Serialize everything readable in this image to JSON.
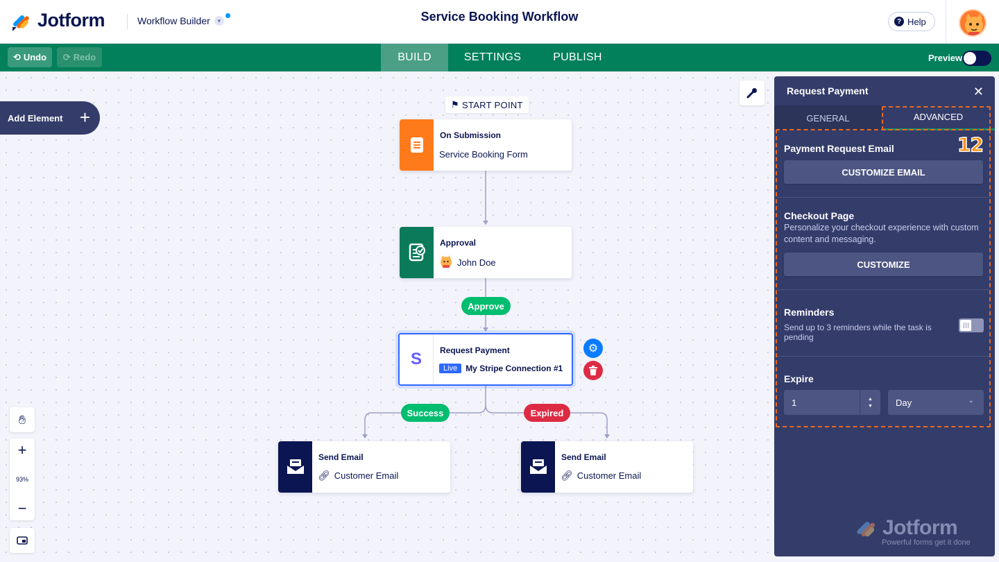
{
  "header": {
    "brand": "Jotform",
    "app_name": "Workflow Builder",
    "doc_title": "Service Booking Workflow",
    "help_label": "Help"
  },
  "nav": {
    "undo": "Undo",
    "redo": "Redo",
    "tabs": [
      "BUILD",
      "SETTINGS",
      "PUBLISH"
    ],
    "active_tab": "BUILD",
    "preview_label": "Preview"
  },
  "canvas": {
    "add_element": "Add Element",
    "start_point": "START POINT",
    "zoom": "93%",
    "nodes": {
      "submission": {
        "title": "On Submission",
        "subtitle": "Service Booking Form"
      },
      "approval": {
        "title": "Approval",
        "assignee": "John Doe"
      },
      "payment": {
        "title": "Request Payment",
        "mode_badge": "Live",
        "connection": "My Stripe Connection #1"
      },
      "email_success": {
        "title": "Send Email",
        "recipient": "Customer Email"
      },
      "email_expired": {
        "title": "Send Email",
        "recipient": "Customer Email"
      }
    },
    "branch_labels": {
      "approve": "Approve",
      "success": "Success",
      "expired": "Expired"
    }
  },
  "panel": {
    "title": "Request Payment",
    "tabs": [
      "GENERAL",
      "ADVANCED"
    ],
    "active_tab": "ADVANCED",
    "annotation_number": "12",
    "payment_email": {
      "title": "Payment Request Email",
      "button": "CUSTOMIZE EMAIL"
    },
    "checkout": {
      "title": "Checkout Page",
      "description": "Personalize your checkout experience with custom content and messaging.",
      "button": "CUSTOMIZE"
    },
    "reminders": {
      "title": "Reminders",
      "description": "Send up to 3 reminders while the task is pending",
      "enabled": false
    },
    "expire": {
      "title": "Expire",
      "value": "1",
      "unit": "Day"
    },
    "watermark": {
      "brand": "Jotform",
      "tagline": "Powerful forms get it done"
    }
  },
  "colors": {
    "nav_green": "#01805b",
    "panel_bg": "#343c6a",
    "submission_orange": "#ff7a1a",
    "approval_green": "#0a7a5a",
    "email_navy": "#0a1551",
    "approve_green": "#01bd6f",
    "expired_red": "#dc2b43",
    "annotation_orange": "#ec6a1c"
  }
}
